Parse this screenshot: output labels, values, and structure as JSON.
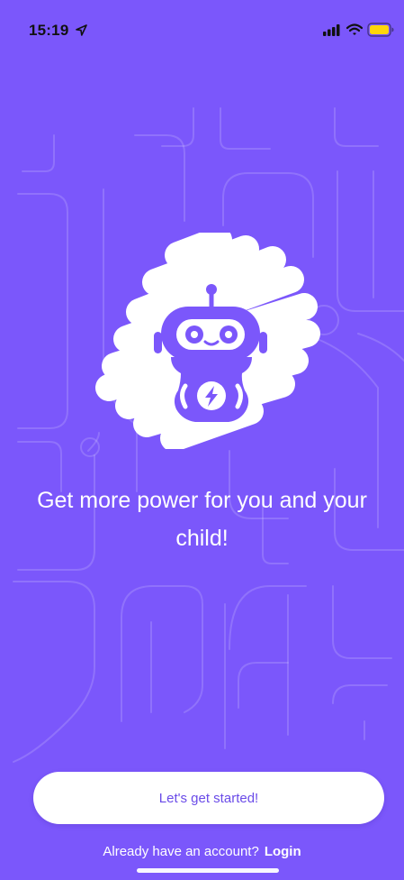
{
  "status_bar": {
    "time": "15:19",
    "icons": [
      "location-arrow-icon",
      "signal-icon",
      "wifi-icon",
      "battery-icon"
    ],
    "battery_color": "#ffd60a"
  },
  "illustration": {
    "name": "robot-mascot",
    "icon": "robot-icon",
    "badge_icon": "lightning-bolt-icon"
  },
  "headline": "Get more power for you and your child!",
  "cta": {
    "label": "Let's get started!"
  },
  "login": {
    "prompt": "Already have an account?",
    "link_label": "Login"
  },
  "colors": {
    "background": "#7b57fb",
    "accent": "#6a4be8",
    "button_background": "#ffffff"
  }
}
